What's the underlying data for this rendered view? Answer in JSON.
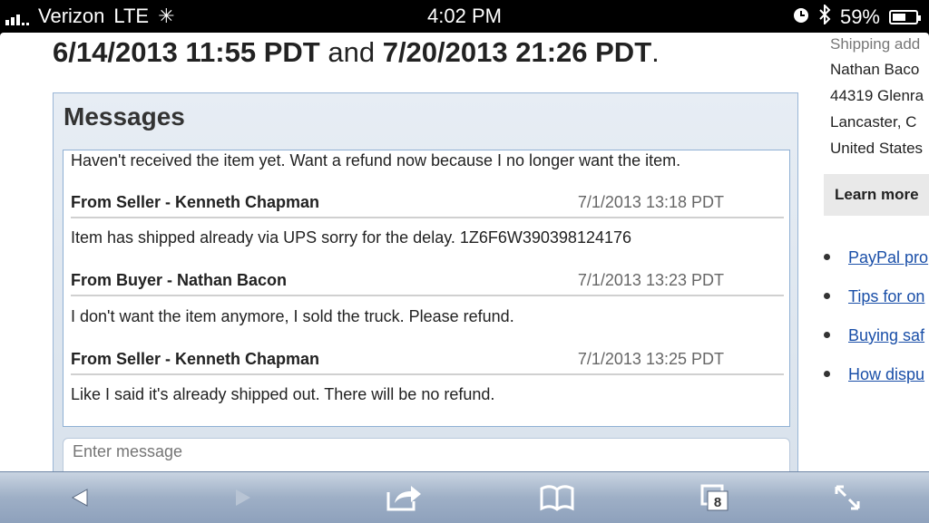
{
  "status_bar": {
    "carrier": "Verizon",
    "network": "LTE",
    "time": "4:02 PM",
    "battery": "59%",
    "battery_level": 0.59,
    "icons": [
      "signal-icon",
      "activity-spinner-icon",
      "alarm-icon",
      "bluetooth-icon",
      "battery-icon"
    ]
  },
  "header": {
    "date_start": "6/14/2013 11:55 PDT",
    "joiner": "and",
    "date_end": "7/20/2013 21:26 PDT",
    "end_punct": "."
  },
  "messages": {
    "title": "Messages",
    "first_body": "Haven't received the item yet. Want a refund now because I no longer want the item.",
    "items": [
      {
        "from": "From Seller - Kenneth Chapman",
        "time": "7/1/2013 13:18 PDT",
        "body": "Item has shipped already via UPS sorry for the delay. 1Z6F6W390398124176"
      },
      {
        "from": "From Buyer - Nathan Bacon",
        "time": "7/1/2013 13:23 PDT",
        "body": "I don't want the item anymore, I sold the truck. Please refund."
      },
      {
        "from": "From Seller - Kenneth Chapman",
        "time": "7/1/2013 13:25 PDT",
        "body": "Like I said it's already shipped out. There will be no refund."
      }
    ],
    "compose_placeholder": "Enter message"
  },
  "sidebar": {
    "shipping_label": "Shipping add",
    "address": [
      "Nathan Baco",
      "44319 Glenra",
      "Lancaster, C",
      "United States"
    ],
    "learn_more": "Learn more",
    "links": [
      "PayPal pro",
      "Tips for on",
      "Buying saf",
      "How dispu"
    ]
  },
  "toolbar": {
    "tabs_count": "8",
    "icons": [
      "back-icon",
      "forward-icon",
      "share-icon",
      "bookmarks-icon",
      "tabs-icon",
      "fullscreen-icon"
    ]
  },
  "colors": {
    "link": "#1a4fa8",
    "panel_border": "#9ab6d6",
    "toolbar": "#9eafc6"
  }
}
